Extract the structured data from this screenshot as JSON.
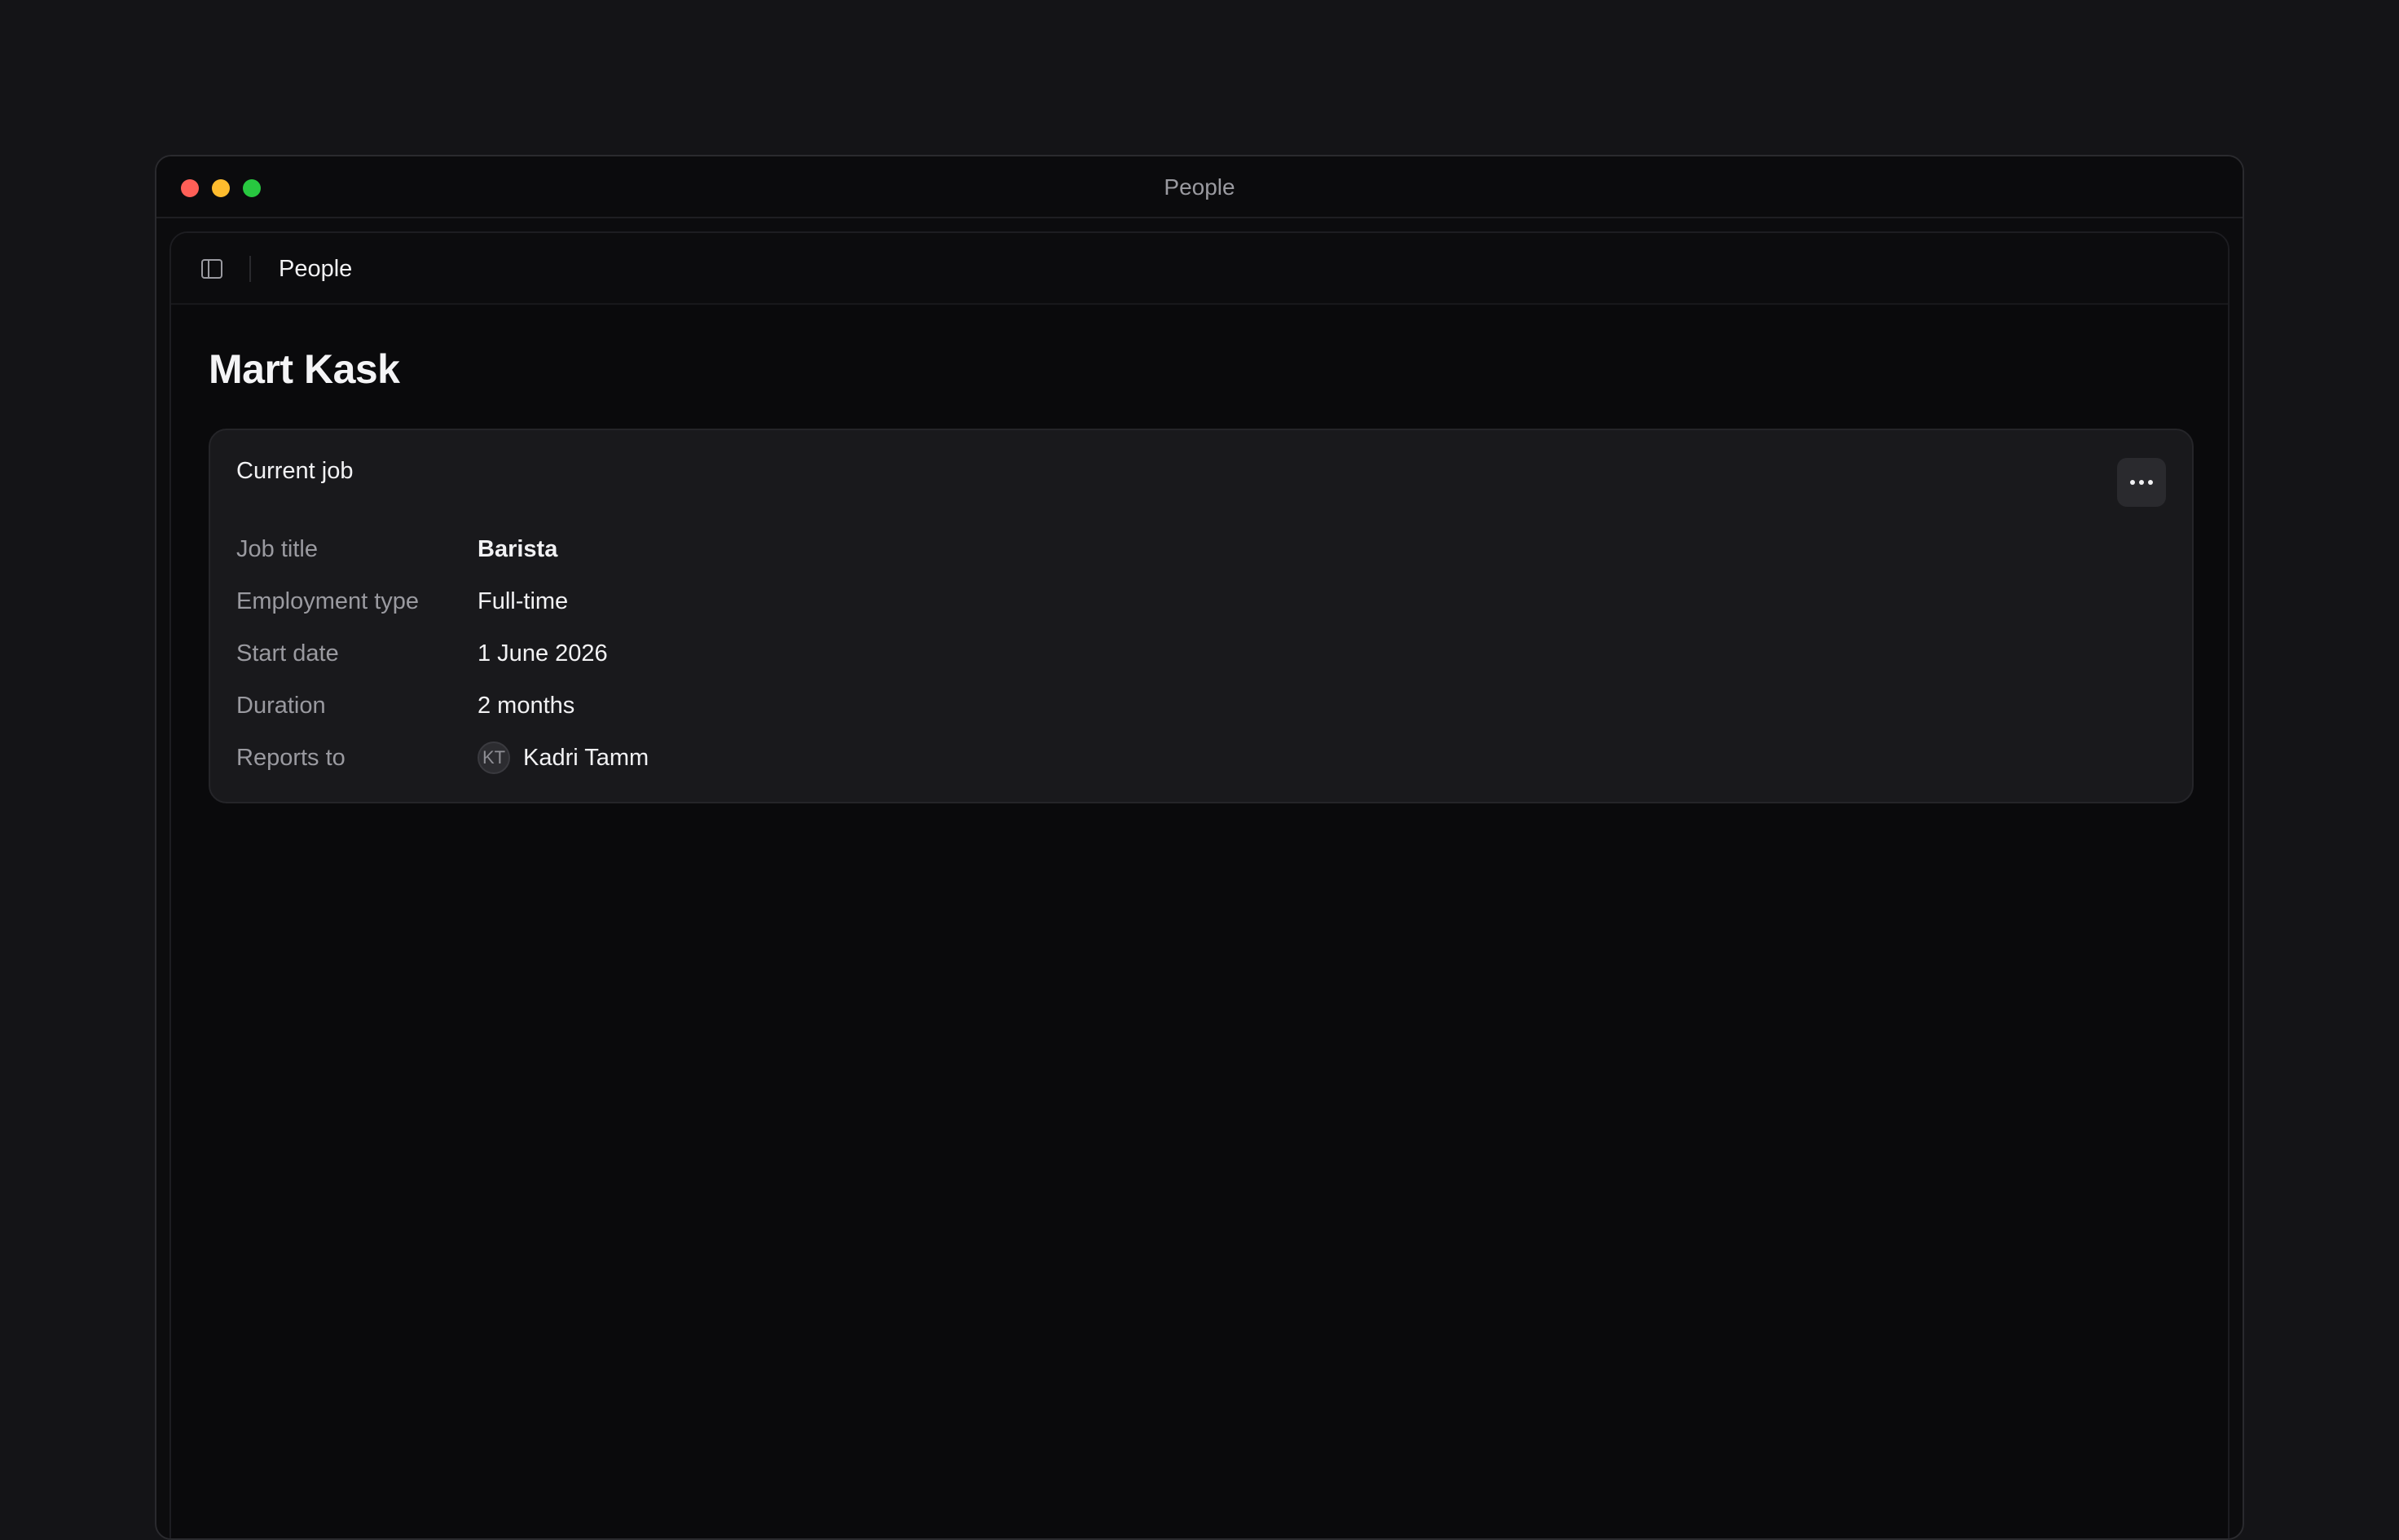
{
  "window": {
    "title": "People",
    "traffic_lights": [
      {
        "name": "close",
        "color": "#ff5f57"
      },
      {
        "name": "minimize",
        "color": "#febc2e"
      },
      {
        "name": "maximize",
        "color": "#28c840"
      }
    ]
  },
  "topbar": {
    "sidebar_toggle_icon": "sidebar-toggle-icon",
    "breadcrumb": "People"
  },
  "page": {
    "title": "Mart Kask"
  },
  "card": {
    "title": "Current job",
    "more_icon": "more-horizontal-icon",
    "fields": {
      "job_title": {
        "label": "Job title",
        "value": "Barista"
      },
      "employment_type": {
        "label": "Employment type",
        "value": "Full-time"
      },
      "start_date": {
        "label": "Start date",
        "value": "1 June 2026"
      },
      "duration": {
        "label": "Duration",
        "value": "2 months"
      },
      "reports_to": {
        "label": "Reports to",
        "initials": "KT",
        "value": "Kadri Tamm"
      }
    }
  }
}
